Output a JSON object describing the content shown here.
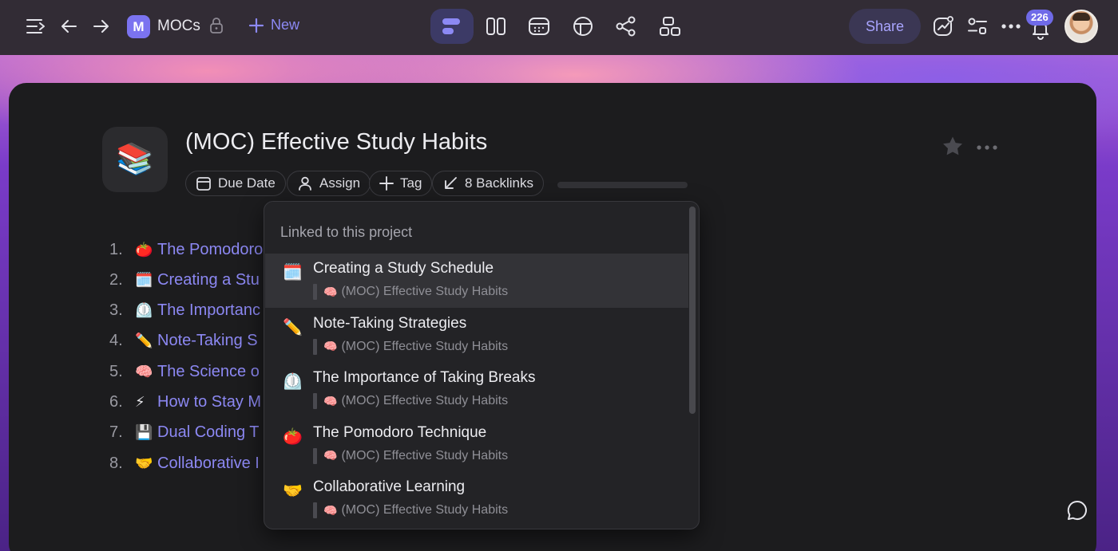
{
  "topbar": {
    "workspace_initial": "M",
    "workspace_name": "MOCs",
    "new_label": "New",
    "share_label": "Share",
    "notification_count": "226",
    "icons": [
      "menu-collapse-icon",
      "back-arrow-icon",
      "forward-arrow-icon",
      "lock-icon",
      "plus-icon",
      "list-view-icon",
      "board-view-icon",
      "calendar-view-icon",
      "table-view-icon",
      "graph-view-icon",
      "canvas-view-icon",
      "analytics-icon",
      "filter-settings-icon",
      "more-horizontal-icon",
      "bell-icon"
    ]
  },
  "document": {
    "icon_emoji": "📚",
    "title": "(MOC) Effective Study Habits",
    "chips": {
      "due_date": "Due Date",
      "assign": "Assign",
      "tag": "Tag",
      "backlinks": "8 Backlinks"
    },
    "list": [
      {
        "num": "1.",
        "emoji": "🍅",
        "text": "The Pomodoro"
      },
      {
        "num": "2.",
        "emoji": "🗓️",
        "text": "Creating a Stu"
      },
      {
        "num": "3.",
        "emoji": "⏲️",
        "text": "The Importanc"
      },
      {
        "num": "4.",
        "emoji": "✏️",
        "text": "Note-Taking S"
      },
      {
        "num": "5.",
        "emoji": "🧠",
        "text": "The Science o"
      },
      {
        "num": "6.",
        "emoji": "⚡",
        "text": "How to Stay M"
      },
      {
        "num": "7.",
        "emoji": "💾",
        "text": "Dual Coding T"
      },
      {
        "num": "8.",
        "emoji": "🤝",
        "text": "Collaborative I"
      }
    ]
  },
  "backlinks_popover": {
    "heading": "Linked to this project",
    "items": [
      {
        "emoji": "🗓️",
        "title": "Creating a Study Schedule",
        "parent_emoji": "🧠",
        "parent": "(MOC) Effective Study Habits",
        "active": true
      },
      {
        "emoji": "✏️",
        "title": "Note-Taking Strategies",
        "parent_emoji": "🧠",
        "parent": "(MOC) Effective Study Habits"
      },
      {
        "emoji": "⏲️",
        "title": "The Importance of Taking Breaks",
        "parent_emoji": "🧠",
        "parent": "(MOC) Effective Study Habits"
      },
      {
        "emoji": "🍅",
        "title": "The Pomodoro Technique",
        "parent_emoji": "🧠",
        "parent": "(MOC) Effective Study Habits"
      },
      {
        "emoji": "🤝",
        "title": "Collaborative Learning",
        "parent_emoji": "🧠",
        "parent": "(MOC) Effective Study Habits"
      }
    ]
  },
  "colors": {
    "accent": "#8c88f3",
    "card_bg": "#1c1c1e",
    "topbar_bg": "#322c35"
  }
}
